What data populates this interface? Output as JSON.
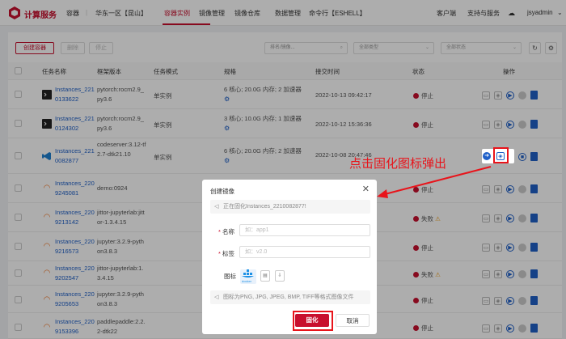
{
  "header": {
    "brand": "计算服务",
    "nav": [
      "容器",
      "华东一区【昆山】",
      "容器实例",
      "镜像管理",
      "镜像仓库",
      "数据管理",
      "命令行【ESHELL】"
    ],
    "active_nav": "容器实例",
    "right": [
      "客户端",
      "支持与服务",
      "jsyadmin"
    ],
    "accent": "#c8102e"
  },
  "toolbar": {
    "create_label": "创建容器",
    "delete_label": "删除",
    "stop_label": "停止",
    "search_placeholder": "排名/镜像...",
    "type_filter": "全部类型",
    "status_filter": "全部状态"
  },
  "table": {
    "columns": [
      "任务名称",
      "框架版本",
      "任务模式",
      "规格",
      "接交时间",
      "状态",
      "操作"
    ],
    "rows": [
      {
        "name": "Instances_2210133622",
        "framework": "pytorch:rocm2.9_py3.6",
        "mode": "单实例",
        "spec": "6 核心; 20.0G 内存; 2 加速器",
        "time": "2022-10-13 09:42:17",
        "status": "停止",
        "icon": "terminal"
      },
      {
        "name": "Instances_2210124302",
        "framework": "pytorch:rocm2.9_py3.6",
        "mode": "单实例",
        "spec": "3 核心; 10.0G 内存; 1 加速器",
        "time": "2022-10-12 15:36:36",
        "status": "停止",
        "icon": "terminal"
      },
      {
        "name": "Instances_2210082877",
        "framework": "codeserver:3.12-tf2.7-dtk21.10",
        "mode": "单实例",
        "spec": "6 核心; 20.0G 内存; 2 加速器",
        "time": "2022-10-08 20:47:46",
        "status": "",
        "icon": "vscode"
      },
      {
        "name": "Instances_2209245081",
        "framework": "demo:0924",
        "mode": "",
        "spec": "",
        "time": "",
        "status": "停止",
        "icon": "jupyter"
      },
      {
        "name": "Instances_2209213142",
        "framework": "jittor-jupyterlab:jittor-1.3.4.15",
        "mode": "",
        "spec": "",
        "time": "",
        "status": "失败",
        "icon": "jupyter"
      },
      {
        "name": "Instances_2209216573",
        "framework": "jupyter:3.2.9-python3.8.3",
        "mode": "",
        "spec": "",
        "time": "",
        "status": "停止",
        "icon": "jupyter"
      },
      {
        "name": "Instances_2209202547",
        "framework": "jittor-jupyterlab:1.3.4.15",
        "mode": "",
        "spec": "",
        "time": "",
        "status": "失败",
        "icon": "jupyter"
      },
      {
        "name": "Instances_2209205653",
        "framework": "jupyter:3.2.9-python3.8.3",
        "mode": "",
        "spec": "",
        "time": "",
        "status": "停止",
        "icon": "jupyter"
      },
      {
        "name": "Instances_2209153396",
        "framework": "paddlepaddle:2.2.2-dtk22",
        "mode": "",
        "spec": "",
        "time": "",
        "status": "停止",
        "icon": "jupyter"
      }
    ]
  },
  "modal": {
    "title": "创建镜像",
    "info": "正在固化Instances_2210082877!",
    "name_label": "名称",
    "name_placeholder": "如：app1",
    "tag_label": "标签",
    "tag_placeholder": "如：v2.0",
    "icon_label": "图标",
    "docker_text": "docker",
    "hint": "图标为PNG, JPG, JPEG, BMP, TIFF等格式图像文件",
    "confirm_label": "固化",
    "cancel_label": "取消"
  },
  "annotation": {
    "callout": "点击固化图标弹出",
    "color": "#e8141b"
  }
}
